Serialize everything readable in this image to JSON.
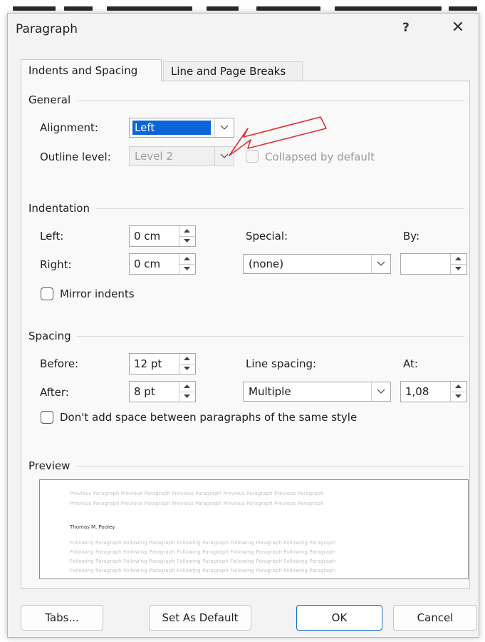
{
  "dialog": {
    "title": "Paragraph",
    "help": "?",
    "close": "✕"
  },
  "tabs": [
    {
      "label": "Indents and Spacing",
      "active": true
    },
    {
      "label": "Line and Page Breaks",
      "active": false
    }
  ],
  "general": {
    "section": "General",
    "alignment_label": "Alignment:",
    "alignment_value": "Left",
    "outline_label": "Outline level:",
    "outline_value": "Level 2",
    "collapsed_label": "Collapsed by default"
  },
  "indentation": {
    "section": "Indentation",
    "left_label": "Left:",
    "left_value": "0 cm",
    "right_label": "Right:",
    "right_value": "0 cm",
    "special_label": "Special:",
    "special_value": "(none)",
    "by_label": "By:",
    "by_value": "",
    "mirror_label": "Mirror indents"
  },
  "spacing": {
    "section": "Spacing",
    "before_label": "Before:",
    "before_value": "12 pt",
    "after_label": "After:",
    "after_value": "8 pt",
    "line_spacing_label": "Line spacing:",
    "line_spacing_value": "Multiple",
    "at_label": "At:",
    "at_value": "1,08",
    "dont_add_label": "Don't add space between paragraphs of the same style"
  },
  "preview": {
    "section": "Preview",
    "previous_lines": [
      "Previous Paragraph Previous Paragraph Previous Paragraph Previous Paragraph Previous Paragraph",
      "Previous Paragraph Previous Paragraph Previous Paragraph Previous Paragraph Previous Paragraph"
    ],
    "sample_text": "Thomas M. Pooley",
    "following_lines": [
      "Following Paragraph Following Paragraph Following Paragraph Following Paragraph Following Paragraph",
      "Following Paragraph Following Paragraph Following Paragraph Following Paragraph Following Paragraph",
      "Following Paragraph Following Paragraph Following Paragraph Following Paragraph Following Paragraph",
      "Following Paragraph Following Paragraph Following Paragraph Following Paragraph Following Paragraph"
    ]
  },
  "buttons": {
    "tabs": "Tabs...",
    "set_default": "Set As Default",
    "ok": "OK",
    "cancel": "Cancel"
  },
  "annotation": {
    "arrow_color": "#e03030"
  },
  "colors": {
    "accent": "#0f6cbd",
    "selection": "#0a66d6"
  }
}
